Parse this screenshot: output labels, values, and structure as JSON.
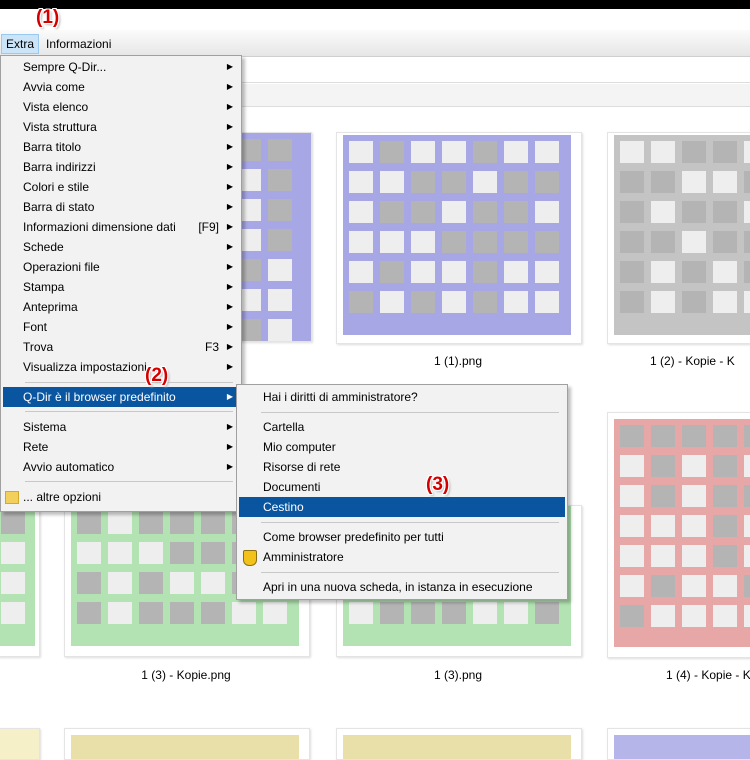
{
  "menubar": {
    "extra": "Extra",
    "info": "Informazioni"
  },
  "callouts": [
    "(1)",
    "(2)",
    "(3)"
  ],
  "thumbnails": [
    {
      "caption": "1 (1).png",
      "color": "#a7a7e6"
    },
    {
      "caption": "1 (2) - Kopie - K",
      "color": "#c4c4c4"
    },
    {
      "caption": "1 (3) - Kopie.png",
      "color": "#b3e3b3"
    },
    {
      "caption": "1 (3).png",
      "color": "#b3e3b3"
    },
    {
      "caption": "1 (4) - Kopie - K",
      "color": "#e8a7a7"
    }
  ],
  "menu1": {
    "items": [
      {
        "label": "Sempre Q-Dir...",
        "shortcut": "",
        "arrow": true
      },
      {
        "label": "Avvia come",
        "shortcut": "",
        "arrow": true
      },
      {
        "label": "Vista elenco",
        "shortcut": "",
        "arrow": true
      },
      {
        "label": "Vista struttura",
        "shortcut": "",
        "arrow": true
      },
      {
        "label": "Barra titolo",
        "shortcut": "",
        "arrow": true
      },
      {
        "label": "Barra indirizzi",
        "shortcut": "",
        "arrow": true
      },
      {
        "label": "Colori e stile",
        "shortcut": "",
        "arrow": true
      },
      {
        "label": "Barra di stato",
        "shortcut": "",
        "arrow": true
      },
      {
        "label": "Informazioni dimensione dati",
        "shortcut": "[F9]",
        "arrow": true
      },
      {
        "label": "Schede",
        "shortcut": "",
        "arrow": true
      },
      {
        "label": "Operazioni file",
        "shortcut": "",
        "arrow": true
      },
      {
        "label": "Stampa",
        "shortcut": "",
        "arrow": true
      },
      {
        "label": "Anteprima",
        "shortcut": "",
        "arrow": true
      },
      {
        "label": "Font",
        "shortcut": "",
        "arrow": true
      },
      {
        "label": "Trova",
        "shortcut": "F3",
        "arrow": true
      },
      {
        "label": "Visualizza impostazioni",
        "shortcut": "",
        "arrow": true
      },
      {
        "label": "Q-Dir è il browser predefinito",
        "shortcut": "",
        "arrow": true,
        "selected": true
      },
      {
        "label": "Sistema",
        "shortcut": "",
        "arrow": true
      },
      {
        "label": "Rete",
        "shortcut": "",
        "arrow": true
      },
      {
        "label": "Avvio automatico",
        "shortcut": "",
        "arrow": true
      },
      {
        "label": "... altre opzioni",
        "shortcut": "",
        "arrow": false,
        "icon": "folder-icon"
      }
    ]
  },
  "menu2": {
    "items": [
      {
        "label": "Hai i diritti di amministratore?"
      },
      {
        "label": "Cartella"
      },
      {
        "label": "Mio computer"
      },
      {
        "label": "Risorse di rete"
      },
      {
        "label": "Documenti"
      },
      {
        "label": "Cestino",
        "selected": true
      },
      {
        "label": "Come browser predefinito per tutti"
      },
      {
        "label": "Amministratore",
        "icon": "shield-icon"
      },
      {
        "label": "Apri in una nuova scheda, in istanza in esecuzione"
      }
    ]
  }
}
